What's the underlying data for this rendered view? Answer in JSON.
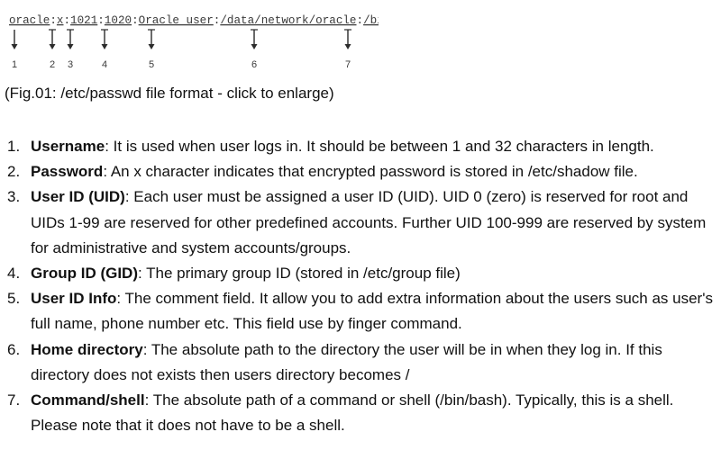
{
  "figure": {
    "passwd_line": {
      "segments": [
        "oracle",
        ":",
        "x",
        ":",
        "1021",
        ":",
        "1020",
        ":",
        "Oracle user",
        ":",
        "/data/network/oracle",
        ":",
        "/bin/bash"
      ]
    },
    "markers": [
      "1",
      "2",
      "3",
      "4",
      "5",
      "6",
      "7"
    ],
    "text_color": "#3a3a3a",
    "line_color": "#2b2b2b"
  },
  "caption": "(Fig.01: /etc/passwd file format - click to enlarge)",
  "fields": [
    {
      "number": "1.",
      "name": "Username",
      "description": ": It is used when user logs in. It should be between 1 and 32 characters in length."
    },
    {
      "number": "2.",
      "name": "Password",
      "description": ": An x character indicates that encrypted password is stored in /etc/shadow file."
    },
    {
      "number": "3.",
      "name": "User ID (UID)",
      "description": ": Each user must be assigned a user ID (UID). UID 0 (zero) is reserved for root and UIDs 1-99 are reserved for other predefined accounts. Further UID 100-999 are reserved by system for administrative and system accounts/groups."
    },
    {
      "number": "4.",
      "name": "Group ID (GID)",
      "description": ": The primary group ID (stored in /etc/group file)"
    },
    {
      "number": "5.",
      "name": "User ID Info",
      "description": ": The comment field. It allow you to add extra information about the users such as user's full name, phone number etc. This field use by finger command."
    },
    {
      "number": "6.",
      "name": "Home directory",
      "description": ": The absolute path to the directory the user will be in when they log in. If this directory does not exists then users directory becomes /"
    },
    {
      "number": "7.",
      "name": "Command/shell",
      "description": ": The absolute path of a command or shell (/bin/bash). Typically, this is a shell. Please note that it does not have to be a shell."
    }
  ]
}
